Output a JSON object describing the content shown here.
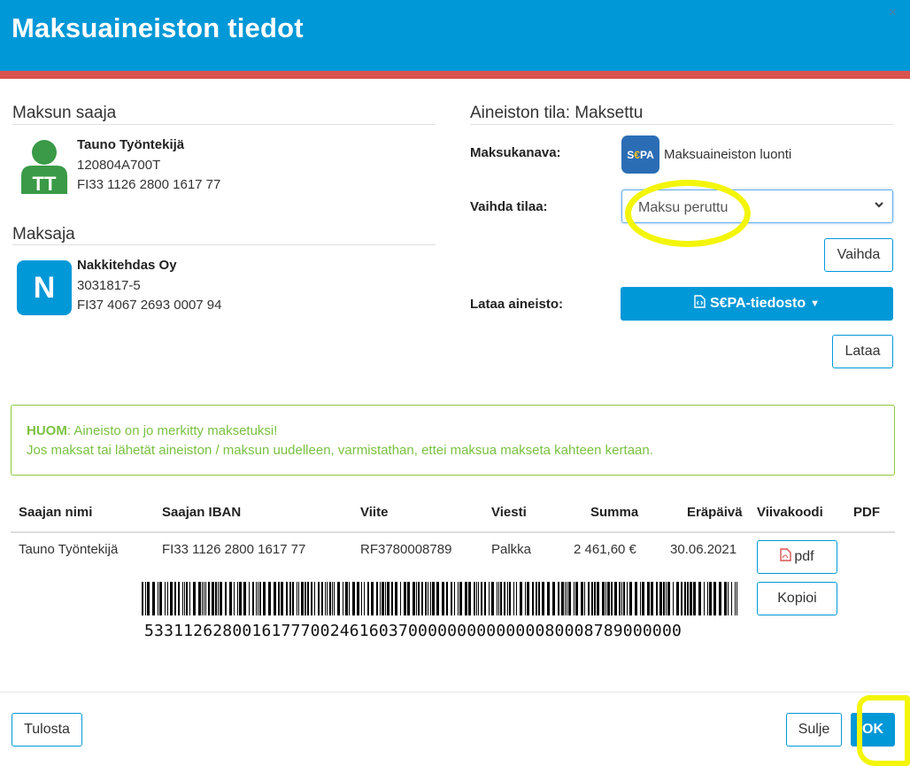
{
  "dialog": {
    "title": "Maksuaineiston tiedot",
    "close": "×"
  },
  "payee": {
    "section_title": "Maksun saaja",
    "avatar_initials": "TT",
    "name": "Tauno Työntekijä",
    "id": "120804A700T",
    "iban": "FI33 1126 2800 1617 77"
  },
  "payer": {
    "section_title": "Maksaja",
    "avatar_initials": "N",
    "name": "Nakkitehdas Oy",
    "id": "3031817-5",
    "iban": "FI37 4067 2693 0007 94"
  },
  "status": {
    "section_title": "Aineiston tila: Maksettu",
    "channel_label": "Maksukanava:",
    "channel_logo": "S€PA",
    "channel_value": "Maksuaineiston luonti",
    "change_label": "Vaihda tilaa:",
    "change_selected": "Maksu peruttu",
    "change_button": "Vaihda",
    "download_label": "Lataa aineisto:",
    "download_format": "S€PA-tiedosto",
    "download_button": "Lataa"
  },
  "alert": {
    "strong": "HUOM",
    "line1_rest": ": Aineisto on jo merkitty maksetuksi!",
    "line2": "Jos maksat tai lähetät aineiston / maksun uudelleen, varmistathan, ettei maksua makseta kahteen kertaan."
  },
  "table": {
    "headers": {
      "name": "Saajan nimi",
      "iban": "Saajan IBAN",
      "ref": "Viite",
      "message": "Viesti",
      "amount": "Summa",
      "due": "Eräpäivä",
      "barcode": "Viivakoodi",
      "pdf": "PDF"
    },
    "row": {
      "name": "Tauno Työntekijä",
      "iban": "FI33 1126 2800 1617 77",
      "ref": "RF3780008789",
      "message": "Palkka",
      "amount": "2 461,60 €",
      "due": "30.06.2021",
      "pdf_button": "pdf",
      "copy_button": "Kopioi",
      "barcode_digits": "533112628001617770024616037000000000000008000878900000​0"
    }
  },
  "footer": {
    "print_button": "Tulosta",
    "close_button": "Sulje",
    "ok_button": "OK"
  },
  "colors": {
    "header": "#0198d7",
    "stripe": "#d9534f",
    "alert_green": "#7ac143",
    "avatar_green": "#3a9a47",
    "highlight": "#f3f50a"
  }
}
